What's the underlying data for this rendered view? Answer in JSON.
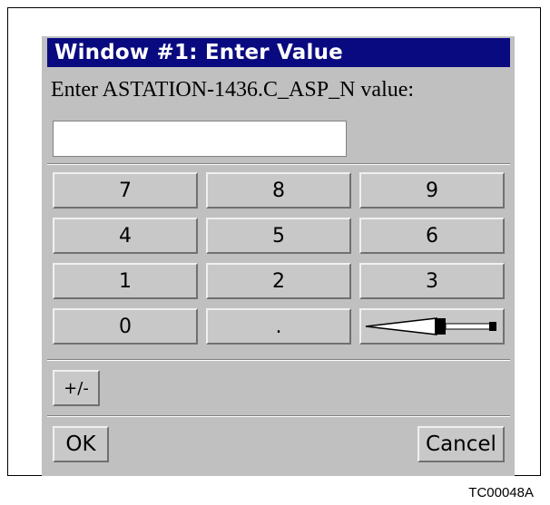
{
  "dialog": {
    "title": "Window #1: Enter Value",
    "prompt": "Enter ASTATION-1436.C_ASP_N value:",
    "input_value": "",
    "keypad": {
      "row0": [
        "7",
        "8",
        "9"
      ],
      "row1": [
        "4",
        "5",
        "6"
      ],
      "row2": [
        "1",
        "2",
        "3"
      ],
      "row3": [
        "0",
        "."
      ],
      "backspace_icon": "backspace-arrow-icon"
    },
    "sign_label": "+/-",
    "ok_label": "OK",
    "cancel_label": "Cancel"
  },
  "footer": {
    "code": "TC00048A"
  },
  "colors": {
    "titlebar": "#0a0a80",
    "dialog_bg": "#c0c0c0"
  }
}
